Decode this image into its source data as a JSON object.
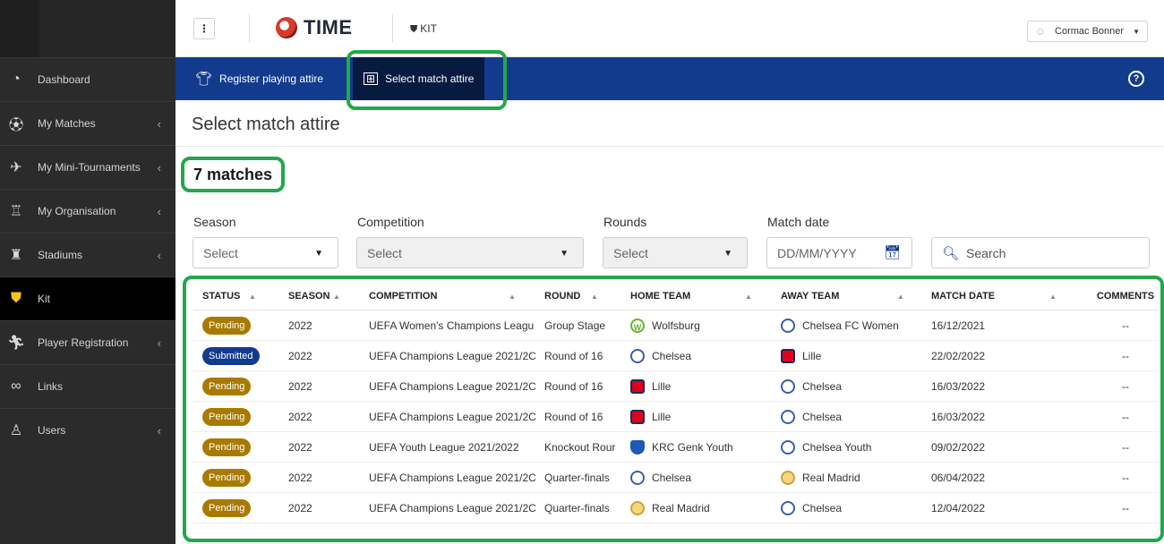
{
  "app": {
    "title": "TIME",
    "breadcrumb": "KIT"
  },
  "user": {
    "name": "Cormac Bonner"
  },
  "sidebar": {
    "items": [
      {
        "label": "Dashboard",
        "icon": "dashboard-icon",
        "chevron": false
      },
      {
        "label": "My Matches",
        "icon": "ball-icon",
        "chevron": true
      },
      {
        "label": "My Mini-Tournaments",
        "icon": "pitch-icon",
        "chevron": true
      },
      {
        "label": "My Organisation",
        "icon": "organisation-icon",
        "chevron": true
      },
      {
        "label": "Stadiums",
        "icon": "stadium-icon",
        "chevron": true
      },
      {
        "label": "Kit",
        "icon": "shield-icon",
        "chevron": false,
        "active": true
      },
      {
        "label": "Player Registration",
        "icon": "player-icon",
        "chevron": true
      },
      {
        "label": "Links",
        "icon": "link-icon",
        "chevron": false
      },
      {
        "label": "Users",
        "icon": "users-icon",
        "chevron": true
      }
    ]
  },
  "tabs": [
    {
      "label": "Register playing attire",
      "icon": "shirt-icon"
    },
    {
      "label": "Select match attire",
      "icon": "jersey-pair-icon",
      "active": true
    }
  ],
  "page": {
    "title": "Select match attire",
    "count": "7 matches"
  },
  "filters": {
    "season": {
      "label": "Season",
      "value": "Select"
    },
    "competition": {
      "label": "Competition",
      "value": "Select"
    },
    "rounds": {
      "label": "Rounds",
      "value": "Select"
    },
    "match_date": {
      "label": "Match date",
      "placeholder": "DD/MM/YYYY"
    },
    "search": {
      "placeholder": "Search"
    }
  },
  "table": {
    "columns": [
      "STATUS",
      "SEASON",
      "COMPETITION",
      "ROUND",
      "HOME TEAM",
      "AWAY TEAM",
      "MATCH DATE",
      "COMMENTS"
    ],
    "rows": [
      {
        "status": "Pending",
        "season": "2022",
        "competition": "UEFA Women's Champions Leagu",
        "round": "Group Stage",
        "home": "Wolfsburg",
        "home_crest": "wolfsburg",
        "away": "Chelsea FC Women",
        "away_crest": "chelsea",
        "date": "16/12/2021",
        "comments": "--"
      },
      {
        "status": "Submitted",
        "season": "2022",
        "competition": "UEFA Champions League 2021/2C",
        "round": "Round of 16",
        "home": "Chelsea",
        "home_crest": "chelsea",
        "away": "Lille",
        "away_crest": "lille",
        "date": "22/02/2022",
        "comments": "--"
      },
      {
        "status": "Pending",
        "season": "2022",
        "competition": "UEFA Champions League 2021/2C",
        "round": "Round of 16",
        "home": "Lille",
        "home_crest": "lille",
        "away": "Chelsea",
        "away_crest": "chelsea",
        "date": "16/03/2022",
        "comments": "--"
      },
      {
        "status": "Pending",
        "season": "2022",
        "competition": "UEFA Champions League 2021/2C",
        "round": "Round of 16",
        "home": "Lille",
        "home_crest": "lille",
        "away": "Chelsea",
        "away_crest": "chelsea",
        "date": "16/03/2022",
        "comments": "--"
      },
      {
        "status": "Pending",
        "season": "2022",
        "competition": "UEFA Youth League 2021/2022",
        "round": "Knockout Rour",
        "home": "KRC Genk Youth",
        "home_crest": "genk",
        "away": "Chelsea Youth",
        "away_crest": "chelsea",
        "date": "09/02/2022",
        "comments": "--"
      },
      {
        "status": "Pending",
        "season": "2022",
        "competition": "UEFA Champions League 2021/2C",
        "round": "Quarter-finals",
        "home": "Chelsea",
        "home_crest": "chelsea",
        "away": "Real Madrid",
        "away_crest": "madrid",
        "date": "06/04/2022",
        "comments": "--"
      },
      {
        "status": "Pending",
        "season": "2022",
        "competition": "UEFA Champions League 2021/2C",
        "round": "Quarter-finals",
        "home": "Real Madrid",
        "home_crest": "madrid",
        "away": "Chelsea",
        "away_crest": "chelsea",
        "date": "12/04/2022",
        "comments": "--"
      }
    ]
  },
  "colors": {
    "brand_blue": "#123b8e",
    "active_tab": "#071a3f",
    "pending": "#a87a00",
    "highlight": "#22a84a",
    "sidebar": "#2b2b2b"
  }
}
